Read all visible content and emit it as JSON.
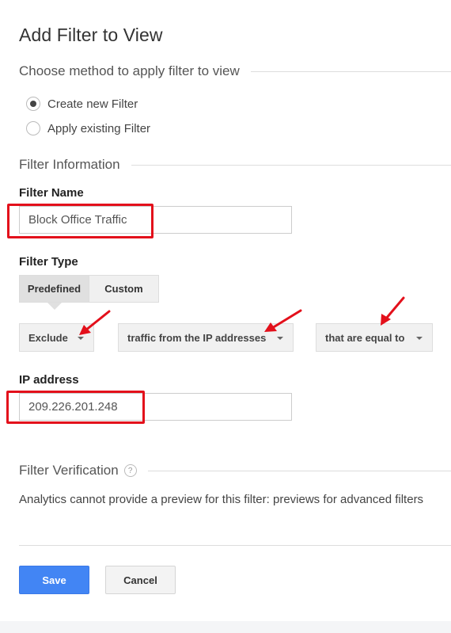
{
  "page": {
    "title": "Add Filter to View"
  },
  "method_section": {
    "heading": "Choose method to apply filter to view",
    "options": [
      {
        "label": "Create new Filter",
        "selected": true
      },
      {
        "label": "Apply existing Filter",
        "selected": false
      }
    ]
  },
  "info_section": {
    "heading": "Filter Information",
    "filter_name_label": "Filter Name",
    "filter_name_value": "Block Office Traffic",
    "filter_type_label": "Filter Type",
    "filter_type_tabs": [
      {
        "label": "Predefined",
        "active": true
      },
      {
        "label": "Custom",
        "active": false
      }
    ],
    "dropdowns": [
      {
        "value": "Exclude"
      },
      {
        "value": "traffic from the IP addresses"
      },
      {
        "value": "that are equal to"
      }
    ],
    "ip_label": "IP address",
    "ip_value": "209.226.201.248"
  },
  "verification_section": {
    "heading": "Filter Verification",
    "help_icon": "question-circle-icon",
    "help_glyph": "?",
    "message": "Analytics cannot provide a preview for this filter: previews for advanced filters"
  },
  "actions": {
    "save_label": "Save",
    "cancel_label": "Cancel"
  },
  "annotations": {
    "highlight_color": "#e3101b",
    "arrow_color": "#e3101b"
  },
  "colors": {
    "primary": "#4285f4"
  }
}
